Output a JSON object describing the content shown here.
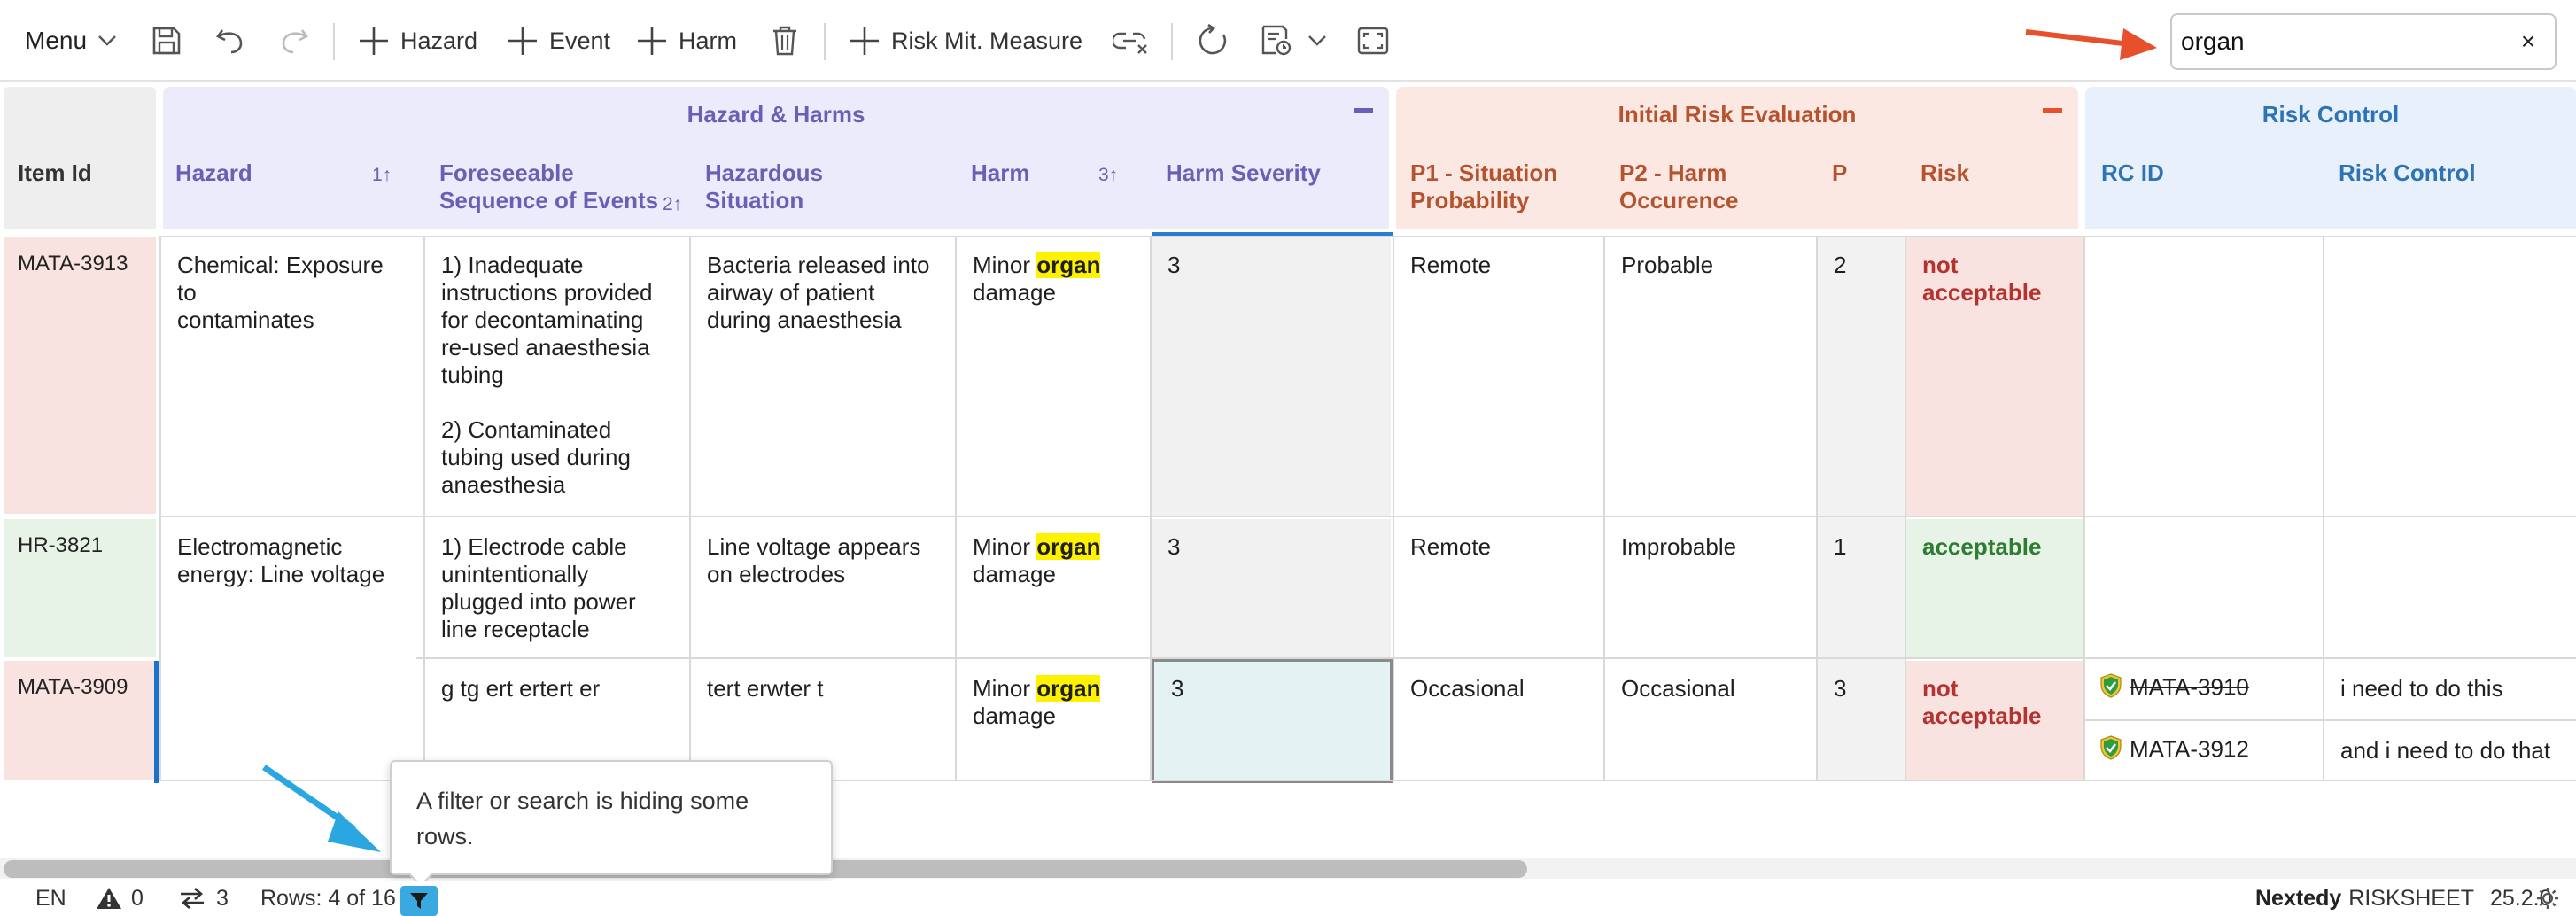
{
  "toolbar": {
    "menu_label": "Menu",
    "add_hazard_label": "Hazard",
    "add_event_label": "Event",
    "add_harm_label": "Harm",
    "add_risk_mit_label": "Risk Mit. Measure",
    "icons": [
      "save-icon",
      "undo-icon",
      "redo-icon",
      "delete-icon",
      "unlink-icon",
      "refresh-icon",
      "report-icon",
      "fullscreen-icon"
    ]
  },
  "search": {
    "value": "organ",
    "clear_label": "×"
  },
  "grid": {
    "item_id_header": "Item Id",
    "groups": {
      "hazard_harms": "Hazard & Harms",
      "initial_risk": "Initial Risk Evaluation",
      "risk_control": "Risk Control"
    },
    "columns": {
      "hazard": "Hazard",
      "hazard_sort": "1↑",
      "sequence_line1": "Foreseeable",
      "sequence_line2": "Sequence of Events",
      "sequence_sort": "2↑",
      "situation_line1": "Hazardous",
      "situation_line2": "Situation",
      "harm": "Harm",
      "harm_sort": "3↑",
      "harm_severity": "Harm Severity",
      "p1_line1": "P1 - Situation",
      "p1_line2": "Probability",
      "p2_line1": "P2 - Harm",
      "p2_line2": "Occurence",
      "p": "P",
      "risk": "Risk",
      "rc_id": "RC ID",
      "risk_control": "Risk Control"
    },
    "rows": [
      {
        "id": "MATA-3913",
        "hazard_line1": "Chemical: Exposure to",
        "hazard_line2": "contaminates",
        "sequence": [
          "1) Inadequate",
          "instructions provided",
          "for decontaminating",
          "re-used anaesthesia",
          "tubing",
          "",
          "2) Contaminated",
          "tubing used during",
          "anaesthesia"
        ],
        "situation": [
          "Bacteria released into",
          "airway of patient",
          "during anaesthesia"
        ],
        "harm_prefix": "Minor ",
        "harm_highlight": "organ",
        "harm_suffix": "damage",
        "severity": "3",
        "p1": "Remote",
        "p2": "Probable",
        "p": "2",
        "risk_line1": "not",
        "risk_line2": "acceptable"
      },
      {
        "id": "HR-3821",
        "hazard_line1": "Electromagnetic",
        "hazard_line2": "energy: Line voltage",
        "sequence": [
          "1) Electrode cable",
          "unintentionally",
          "plugged into power",
          "line receptacle"
        ],
        "situation": [
          "Line voltage appears",
          "on electrodes"
        ],
        "harm_prefix": "Minor ",
        "harm_highlight": "organ",
        "harm_suffix": "damage",
        "severity": "3",
        "p1": "Remote",
        "p2": "Improbable",
        "p": "1",
        "risk_line1": "acceptable"
      },
      {
        "id": "MATA-3909",
        "sequence": [
          "g tg ert ertert er"
        ],
        "situation": [
          "tert erwter t"
        ],
        "harm_prefix": "Minor ",
        "harm_highlight": "organ",
        "harm_suffix": "damage",
        "severity": "3",
        "p1": "Occasional",
        "p2": "Occasional",
        "p": "3",
        "risk_line1": "not",
        "risk_line2": "acceptable",
        "controls": [
          {
            "rc_id": "MATA-3910",
            "text": "i need to do this"
          },
          {
            "rc_id": "MATA-3912",
            "text": "and i need to do that"
          }
        ]
      }
    ]
  },
  "tooltip": {
    "line1": "A filter or search is hiding some",
    "line2": "rows."
  },
  "status": {
    "language": "EN",
    "warnings": "0",
    "links": "3",
    "rows": "Rows: 4 of 16",
    "brand": "Nextedy",
    "product": "RISKSHEET",
    "version": "25.2.0"
  },
  "colors": {
    "hazard_harms_header": "#ecebfb",
    "initial_risk_header": "#fbe8e3",
    "risk_control_header": "#e8f1fb",
    "not_acceptable_bg": "#f9e3e0",
    "acceptable_bg": "#e6f3e6",
    "highlight": "#fff200",
    "annotation_arrow_red": "#e8502b",
    "annotation_arrow_blue": "#2aa7e0"
  }
}
